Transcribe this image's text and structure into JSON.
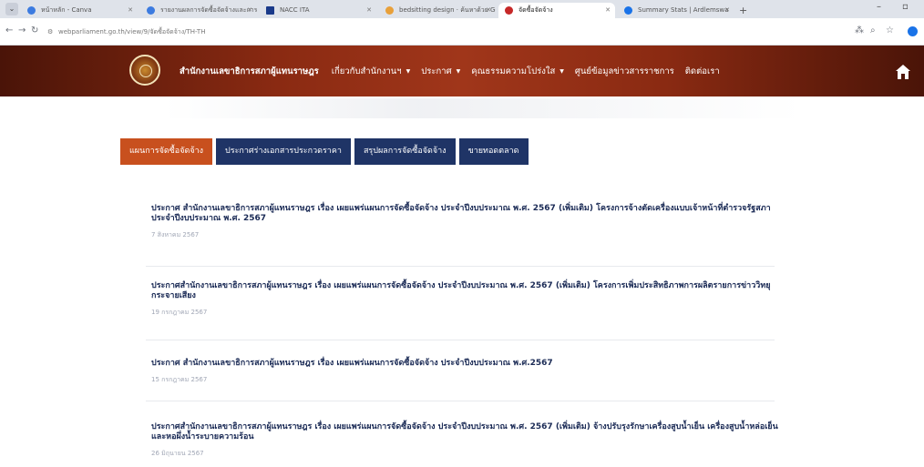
{
  "browser": {
    "tabs": [
      {
        "label": "หน้าหลัก - Canva",
        "color": "#3c7be0"
      },
      {
        "label": "รายงานผลการจัดซื้อจัดจ้างและการบริหาร",
        "color": "#3c7be0"
      },
      {
        "label": "NACC ITA",
        "color": "#1a3a8a"
      },
      {
        "label": "bedsitting design · ค้นหาด้วย Goo",
        "color": "#e8a03a"
      },
      {
        "label": "จัดซื้อจัดจ้าง",
        "color": "#c62828"
      },
      {
        "label": "Summary Stats | Ardlemswa",
        "color": "#1a73e8"
      }
    ],
    "url": "webparliament.go.th/view/9/จัดซื้อจัดจ้าง/TH-TH"
  },
  "header": {
    "org_name": "สำนักงานเลขาธิการสภาผู้แทนราษฎร",
    "nav": [
      {
        "label": "เกี่ยวกับสำนักงานฯ",
        "dropdown": true
      },
      {
        "label": "ประกาศ",
        "dropdown": true
      },
      {
        "label": "คุณธรรมความโปร่งใส",
        "dropdown": true
      },
      {
        "label": "ศูนย์ข้อมูลข่าวสารราชการ",
        "dropdown": false
      },
      {
        "label": "ติดต่อเรา",
        "dropdown": false
      }
    ],
    "colors": {
      "header_dark": "#4a1408",
      "header_mid": "#a0361a"
    }
  },
  "tabs": {
    "items": [
      "แผนการจัดซื้อจัดจ้าง",
      "ประกาศร่างเอกสารประกวดราคา",
      "สรุปผลการจัดซื้อจัดจ้าง",
      "ขายทอดตลาด"
    ],
    "active_color": "#c8501e",
    "inactive_color": "#1f3466"
  },
  "articles": [
    {
      "title": "ประกาศ สำนักงานเลขาธิการสภาผู้แทนราษฎร เรื่อง เผยแพร่แผนการจัดซื้อจัดจ้าง ประจำปีงบประมาณ พ.ศ. 2567 (เพิ่มเติม) โครงการจ้างตัดเครื่องแบบเจ้าหน้าที่ตำรวจรัฐสภา ประจำปีงบประมาณ พ.ศ. 2567",
      "date": "7 สิงหาคม 2567"
    },
    {
      "title": "ประกาศสำนักงานเลขาธิการสภาผู้แทนราษฎร เรื่อง เผยแพร่แผนการจัดซื้อจัดจ้าง ประจำปีงบประมาณ พ.ศ. 2567 (เพิ่มเติม) โครงการเพิ่มประสิทธิภาพการผลิตรายการข่าววิทยุกระจายเสียง",
      "date": "19 กรกฎาคม 2567"
    },
    {
      "title": "ประกาศ สำนักงานเลขาธิการสภาผู้แทนราษฎร เรื่อง เผยแพร่แผนการจัดซื้อจัดจ้าง ประจำปีงบประมาณ พ.ศ.2567",
      "date": "15 กรกฎาคม 2567"
    },
    {
      "title": "ประกาศสำนักงานเลขาธิการสภาผู้แทนราษฎร เรื่อง เผยแพร่แผนการจัดซื้อจัดจ้าง ประจำปีงบประมาณ พ.ศ. 2567 (เพิ่มเติม) จ้างปรับรุงรักษาเครื่องสูบน้ำเย็น เครื่องสูบน้ำหล่อเย็น และหอผึ่งน้ำระบายความร้อน",
      "date": "26 มิถุนายน 2567"
    }
  ]
}
